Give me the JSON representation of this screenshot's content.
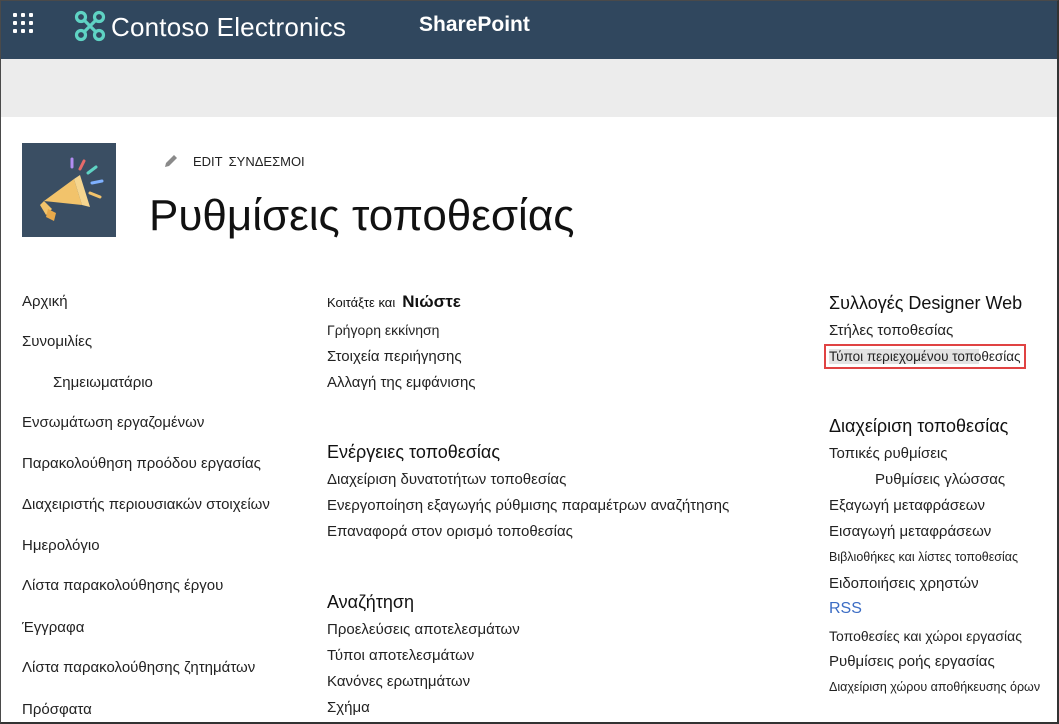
{
  "suite_bar": {
    "brand": "Contoso Electronics",
    "product": "SharePoint",
    "brand_color": "#30475e",
    "waffle_icon": "app-launcher-icon",
    "logo_icon": "contoso-logo-icon"
  },
  "header": {
    "site_logo_icon": "megaphone-icon",
    "edit_icon": "pencil-icon",
    "edit_label": "EDIT",
    "links_label": "ΣΥΝΔΕΣΜΟΙ",
    "page_title": "Ρυθμίσεις τοποθεσίας"
  },
  "left_nav": [
    "Αρχική",
    "Συνομιλίες",
    "Σημειωματάριο",
    "Ενσωμάτωση εργαζομένων",
    "Παρακολούθηση προόδου εργασίας",
    "Διαχειριστής περιουσιακών στοιχείων",
    "Ημερολόγιο",
    "Λίστα παρακολούθησης έργου",
    "Έγγραφα",
    "Λίστα παρακολούθησης ζητημάτων",
    "Πρόσφατα"
  ],
  "look_and_feel": {
    "heading_prefix": "Κοιτάξτε και",
    "heading": "Νιώστε",
    "items": [
      "Γρήγορη εκκίνηση",
      "Στοιχεία περιήγησης",
      "Αλλαγή της εμφάνισης"
    ]
  },
  "site_actions": {
    "heading": "Ενέργειες τοποθεσίας",
    "items": [
      "Διαχείριση δυνατοτήτων τοποθεσίας",
      "Ενεργοποίηση εξαγωγής ρύθμισης παραμέτρων αναζήτησης",
      "Επαναφορά στον ορισμό τοποθεσίας"
    ]
  },
  "search": {
    "heading": "Αναζήτηση",
    "items": [
      "Προελεύσεις αποτελεσμάτων",
      "Τύποι αποτελεσμάτων",
      "Κανόνες ερωτημάτων",
      "Σχήμα"
    ]
  },
  "designer": {
    "heading": "Συλλογές Designer Web",
    "items": [
      "Στήλες τοποθεσίας",
      "Τύποι περιεχομένου τοποθεσίας"
    ]
  },
  "site_admin": {
    "heading": "Διαχείριση τοποθεσίας",
    "items": [
      "Τοπικές ρυθμίσεις",
      "Ρυθμίσεις γλώσσας",
      "Εξαγωγή μεταφράσεων",
      "Εισαγωγή μεταφράσεων",
      "Βιβλιοθήκες και λίστες τοποθεσίας",
      "Ειδοποιήσεις χρηστών",
      "RSS",
      "Τοποθεσίες και χώροι εργασίας",
      "Ρυθμίσεις ροής εργασίας",
      "Διαχείριση χώρου αποθήκευσης όρων"
    ]
  },
  "colors": {
    "highlight_border": "#e04343",
    "rss_link": "#3b6cc4"
  }
}
